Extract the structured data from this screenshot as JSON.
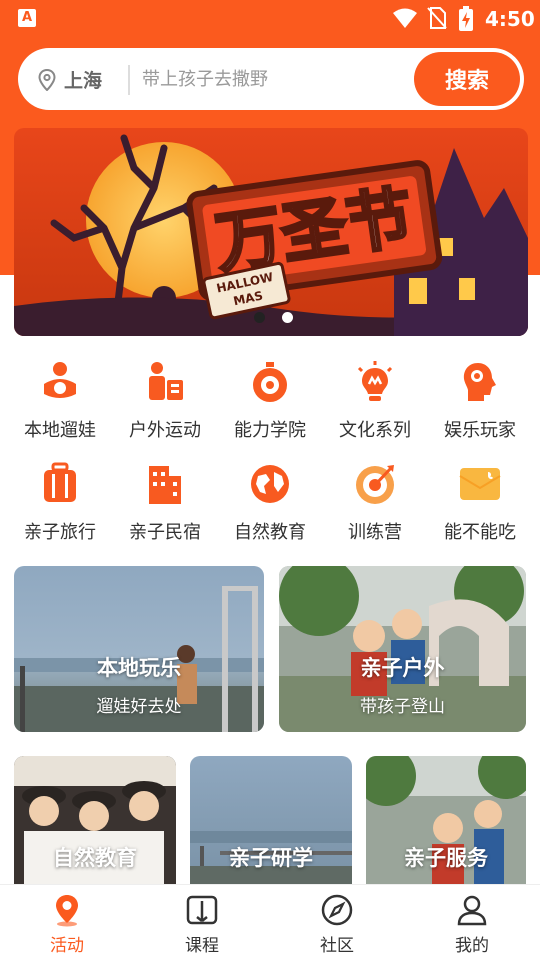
{
  "status_bar": {
    "time": "4:50",
    "app_badge": "A"
  },
  "search": {
    "city": "上海",
    "placeholder": "带上孩子去撒野",
    "button_label": "搜索"
  },
  "banner": {
    "title": "万圣节",
    "sign_text_line1": "HALLOW",
    "sign_text_line2": "MAS",
    "dots": 2,
    "active_dot": 1
  },
  "categories": [
    {
      "label": "本地遛娃",
      "icon": "child-care-icon"
    },
    {
      "label": "户外运动",
      "icon": "outdoor-sports-icon"
    },
    {
      "label": "能力学院",
      "icon": "timer-icon"
    },
    {
      "label": "文化系列",
      "icon": "lightbulb-icon"
    },
    {
      "label": "娱乐玩家",
      "icon": "brain-head-icon"
    },
    {
      "label": "亲子旅行",
      "icon": "suitcase-icon"
    },
    {
      "label": "亲子民宿",
      "icon": "building-icon"
    },
    {
      "label": "自然教育",
      "icon": "globe-icon"
    },
    {
      "label": "训练营",
      "icon": "target-icon"
    },
    {
      "label": "能不能吃",
      "icon": "envelope-icon"
    }
  ],
  "feature_cards": [
    {
      "title": "本地玩乐",
      "subtitle": "遛娃好去处"
    },
    {
      "title": "亲子户外",
      "subtitle": "带孩子登山"
    }
  ],
  "small_cards": [
    {
      "title": "自然教育"
    },
    {
      "title": "亲子研学"
    },
    {
      "title": "亲子服务"
    }
  ],
  "tabs": [
    {
      "label": "活动",
      "icon": "location-pin-icon",
      "active": true
    },
    {
      "label": "课程",
      "icon": "book-icon",
      "active": false
    },
    {
      "label": "社区",
      "icon": "compass-icon",
      "active": false
    },
    {
      "label": "我的",
      "icon": "user-icon",
      "active": false
    }
  ],
  "colors": {
    "accent": "#fb5a1e",
    "icon_orange": "#f85a20",
    "text": "#333333",
    "muted": "#999999"
  }
}
